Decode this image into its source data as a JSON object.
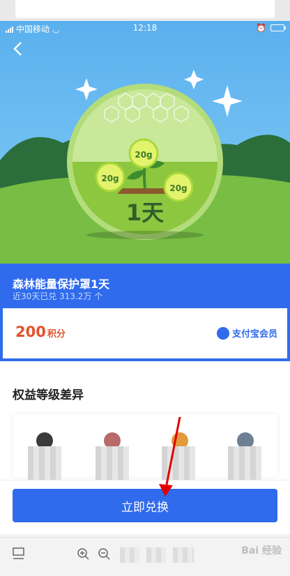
{
  "status_bar": {
    "carrier": "中国移动",
    "time": "12:18"
  },
  "hero": {
    "bubble_left": "20g",
    "bubble_top": "20g",
    "bubble_right": "20g",
    "days_label": "1天"
  },
  "product": {
    "title": "森林能量保护罩1天",
    "subtitle": "近30天已兑 313.2万 个"
  },
  "price": {
    "amount": "200",
    "unit": "积分",
    "member_label": "支付宝会员"
  },
  "benefits": {
    "heading": "权益等级差异"
  },
  "cta": {
    "label": "立即兑换"
  },
  "watermark": "Bai 经验",
  "colors": {
    "primary": "#2f6bec",
    "price": "#e2522b",
    "sky": "#5ab0ee",
    "grass": "#7ac043"
  }
}
